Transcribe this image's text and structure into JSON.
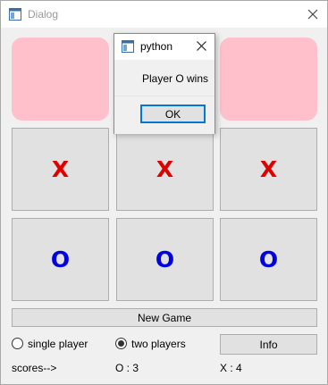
{
  "window": {
    "title": "Dialog"
  },
  "board": {
    "cells": [
      "",
      "",
      "",
      "X",
      "X",
      "X",
      "O",
      "O",
      "O"
    ],
    "colors": {
      "X": "#e00000",
      "O": "#0000e0"
    },
    "highlight_color": "#ffc0cb"
  },
  "controls": {
    "new_game_label": "New Game",
    "single_player_label": "single player",
    "two_players_label": "two players",
    "mode_selected": "two players",
    "info_label": "Info"
  },
  "scores": {
    "label": "scores-->",
    "o_text": "O : 3",
    "x_text": "X : 4"
  },
  "popup": {
    "title": "python",
    "message": "Player O wins",
    "ok_label": "OK"
  }
}
